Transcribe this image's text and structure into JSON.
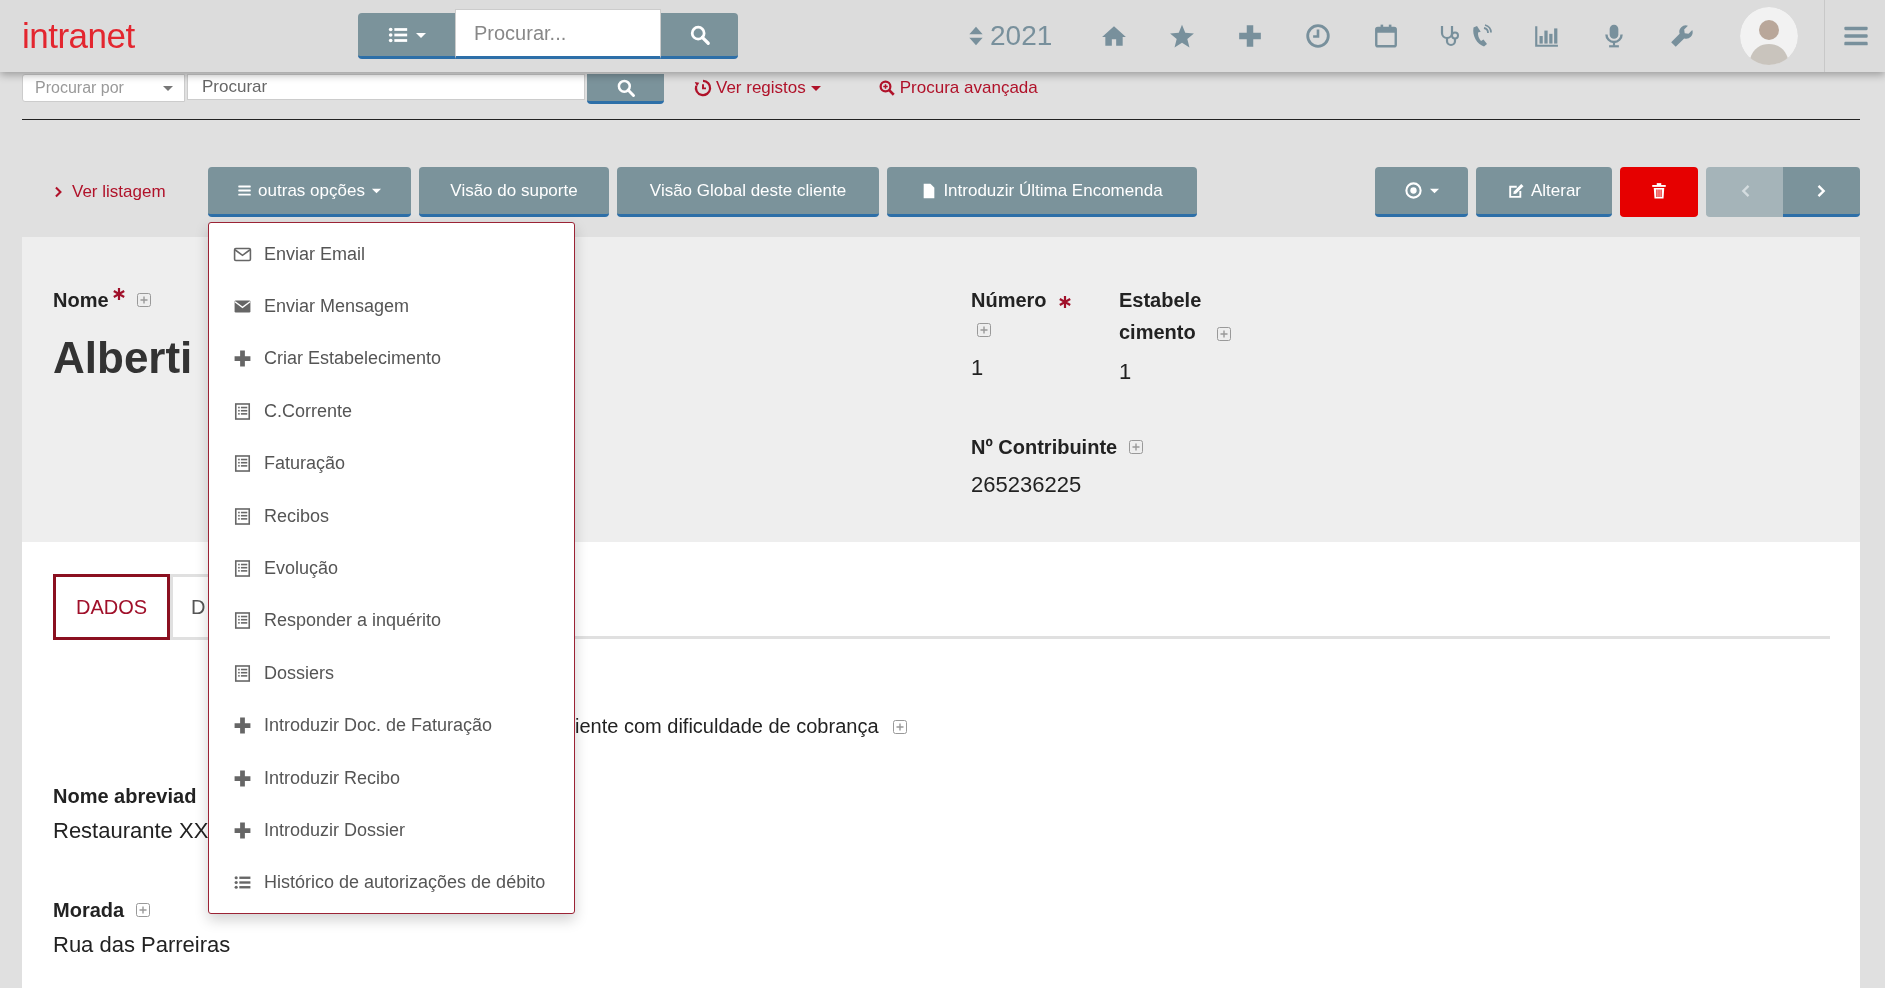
{
  "header": {
    "logo": "intranet",
    "search": {
      "placeholder": "Procurar..."
    },
    "year": "2021"
  },
  "search_row": {
    "select": "Procurar por",
    "placeholder": "Procurar",
    "links": [
      {
        "label": "Ver registos",
        "kind": "history"
      },
      {
        "label": "Procura avançada",
        "kind": "advanced"
      }
    ]
  },
  "toolbar": {
    "back_link": "Ver listagem",
    "buttons": [
      {
        "label": "outras opções",
        "kind": "dropdown"
      },
      {
        "label": "Visão do suporte",
        "kind": "plain"
      },
      {
        "label": "Visão Global deste cliente",
        "kind": "plain"
      },
      {
        "label": "Introduzir Última Encomenda",
        "kind": "document"
      }
    ],
    "edit": "Alterar",
    "nav": [
      {
        "kind": "prev",
        "disabled": true
      },
      {
        "kind": "next",
        "disabled": false
      }
    ]
  },
  "record": {
    "name": {
      "label": "Nome",
      "required": true,
      "add_icon": true,
      "value": "Alberti"
    },
    "side_fields": [
      {
        "label": "Número",
        "required": true,
        "add_icon": true,
        "value": "1"
      },
      {
        "label": "Estabelecimento",
        "required": false,
        "add_icon": true,
        "value": "1"
      }
    ],
    "tax_field": {
      "label": "Nº Contribuinte",
      "required": false,
      "add_icon": true,
      "value": "265236225"
    },
    "tabs": [
      {
        "label": "DADOS",
        "selected": true
      },
      {
        "label": "D",
        "selected": false
      }
    ],
    "flag": {
      "label": "iente com dificuldade de cobrança",
      "add_icon": true
    },
    "fields": [
      {
        "label": "Nome abreviad",
        "add_icon": false,
        "value": "Restaurante XX"
      },
      {
        "label": "Morada",
        "add_icon": true,
        "value": "Rua das Parreiras"
      }
    ]
  },
  "options_menu": {
    "open": true,
    "items": [
      {
        "label": "Enviar Email",
        "kind": "mail-outline"
      },
      {
        "label": "Enviar Mensagem",
        "kind": "mail"
      },
      {
        "label": "Criar Estabelecimento",
        "kind": "plus"
      },
      {
        "label": "C.Corrente",
        "kind": "document"
      },
      {
        "label": "Faturação",
        "kind": "document"
      },
      {
        "label": "Recibos",
        "kind": "document"
      },
      {
        "label": "Evolução",
        "kind": "document"
      },
      {
        "label": "Responder a inquérito",
        "kind": "document"
      },
      {
        "label": "Dossiers",
        "kind": "document"
      },
      {
        "label": "Introduzir Doc. de Faturação",
        "kind": "plus"
      },
      {
        "label": "Introduzir Recibo",
        "kind": "plus"
      },
      {
        "label": "Introduzir Dossier",
        "kind": "plus"
      },
      {
        "label": "Histórico de autorizações de débito",
        "kind": "list"
      }
    ]
  }
}
